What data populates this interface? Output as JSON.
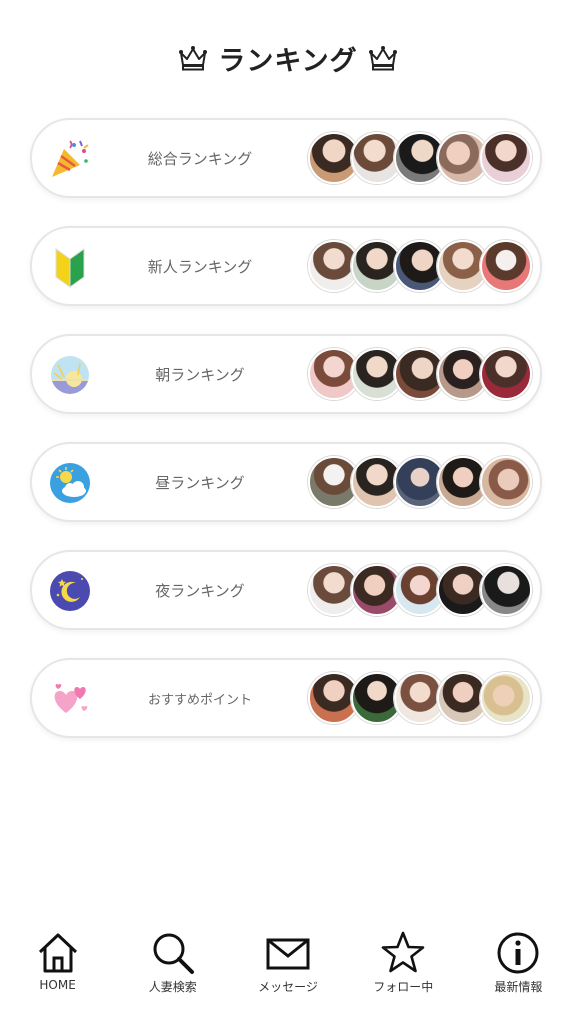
{
  "header": {
    "title": "ランキング",
    "crown_icon": "crown-icon"
  },
  "rankings": [
    {
      "label": "総合ランキング",
      "icon": "party-popper-icon"
    },
    {
      "label": "新人ランキング",
      "icon": "beginner-mark-icon"
    },
    {
      "label": "朝ランキング",
      "icon": "sunrise-icon"
    },
    {
      "label": "昼ランキング",
      "icon": "sun-cloud-icon"
    },
    {
      "label": "夜ランキング",
      "icon": "moon-stars-icon"
    },
    {
      "label": "おすすめポイント",
      "icon": "hearts-icon"
    }
  ],
  "tabbar": {
    "items": [
      {
        "label": "HOME",
        "icon": "home-icon"
      },
      {
        "label": "人妻検索",
        "icon": "search-icon"
      },
      {
        "label": "メッセージ",
        "icon": "mail-icon"
      },
      {
        "label": "フォロー中",
        "icon": "star-icon"
      },
      {
        "label": "最新情報",
        "icon": "info-icon"
      }
    ]
  }
}
